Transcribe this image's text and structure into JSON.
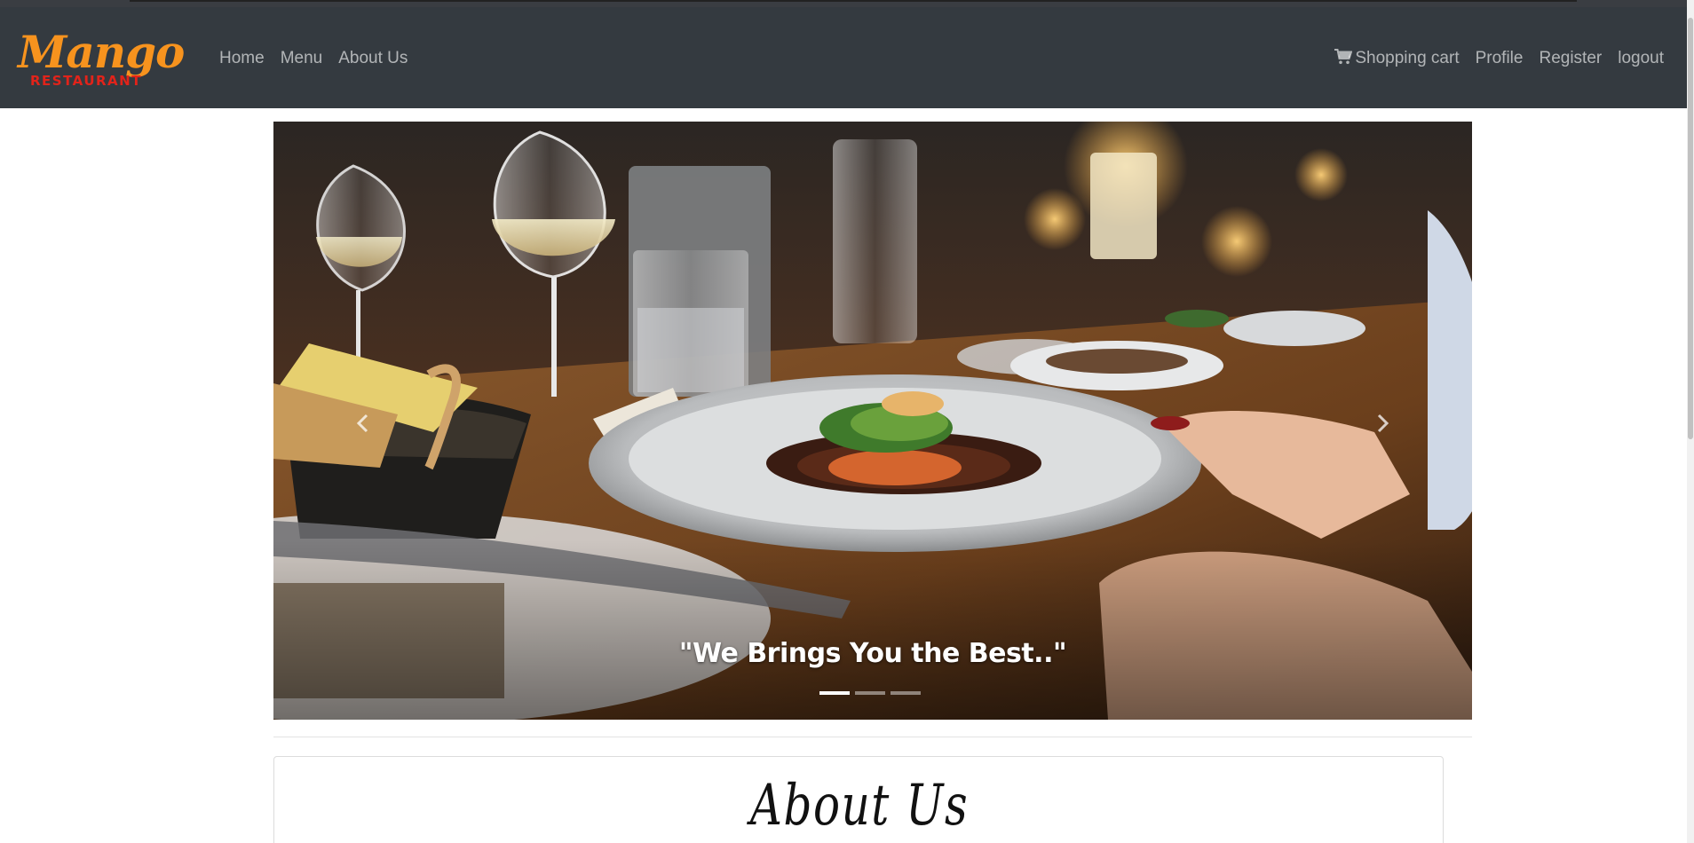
{
  "brand": {
    "name": "Mango",
    "subtitle": "RESTAURANT",
    "primary_color": "#f7931e",
    "secondary_color": "#e2231a"
  },
  "nav": {
    "left": [
      {
        "label": "Home"
      },
      {
        "label": "Menu"
      },
      {
        "label": "About Us"
      }
    ],
    "right": [
      {
        "label": "Shopping cart",
        "icon": "cart-icon"
      },
      {
        "label": "Profile"
      },
      {
        "label": "Register"
      },
      {
        "label": "logout"
      }
    ],
    "background": "#343a40"
  },
  "carousel": {
    "caption": "\"We Brings You the Best..\"",
    "prev_icon": "chevron-left-icon",
    "next_icon": "chevron-right-icon",
    "indicator_count": 3,
    "active_index": 0
  },
  "about": {
    "title": "About Us"
  }
}
